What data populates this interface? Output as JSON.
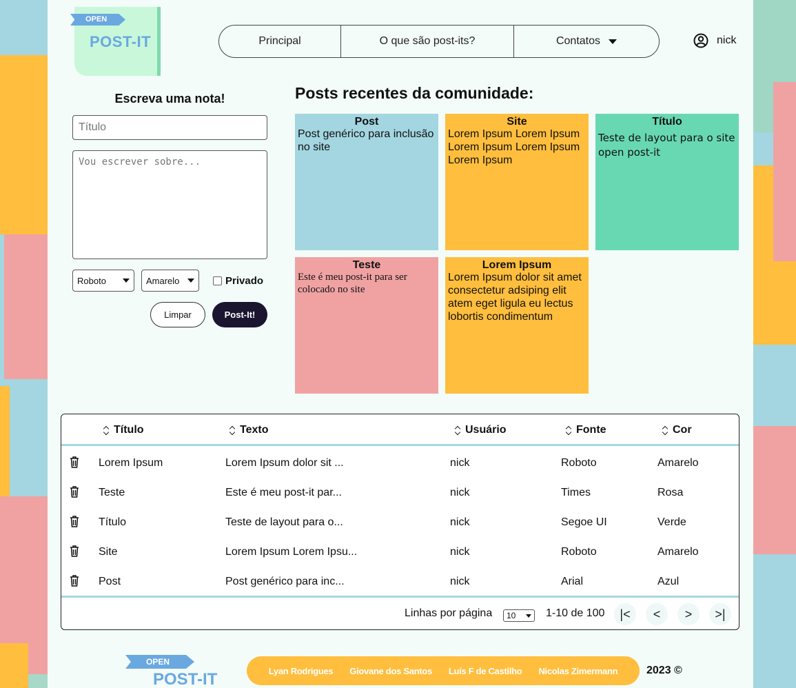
{
  "header": {
    "logo": {
      "ribbon": "OPEN",
      "word": "POST-IT"
    },
    "nav": {
      "principal": "Principal",
      "about": "O que são post-its?",
      "contacts": "Contatos"
    },
    "user": {
      "name": "nick"
    }
  },
  "form": {
    "title": "Escreva uma nota!",
    "title_placeholder": "Título",
    "body_placeholder": "Vou escrever sobre...",
    "font_select": "Roboto",
    "color_select": "Amarelo",
    "private_label": "Privado",
    "clear_label": "Limpar",
    "post_label": "Post-It!"
  },
  "posts": {
    "heading": "Posts recentes da comunidade:",
    "items": [
      {
        "title": "Post",
        "body": "Post genérico para inclusão no site",
        "color": "#a3d6e0"
      },
      {
        "title": "Site",
        "body": "Lorem Ipsum Lorem Ipsum Lorem Ipsum Lorem Ipsum Lorem Ipsum",
        "color": "#ffbe3d"
      },
      {
        "title": "Título",
        "body": "Teste de layout para o site open post-it",
        "color": "#68d8b3"
      },
      {
        "title": "Teste",
        "body": "Este é meu post-it para ser colocado no site",
        "color": "#f0a2a2"
      },
      {
        "title": "Lorem Ipsum",
        "body": "Lorem Ipsum dolor sit amet consectetur adsiping elit atem eget ligula eu lectus lobortis condimentum",
        "color": "#ffbe3d"
      }
    ]
  },
  "table": {
    "headers": [
      "Título",
      "Texto",
      "Usuário",
      "Fonte",
      "Cor"
    ],
    "rows": [
      [
        "Lorem Ipsum",
        "Lorem Ipsum dolor sit ...",
        "nick",
        "Roboto",
        "Amarelo"
      ],
      [
        "Teste",
        "Este é meu post-it par...",
        "nick",
        "Times",
        "Rosa"
      ],
      [
        "Título",
        "Teste de layout para o...",
        "nick",
        "Segoe UI",
        "Verde"
      ],
      [
        "Site",
        "Lorem Ipsum Lorem Ipsu...",
        "nick",
        "Roboto",
        "Amarelo"
      ],
      [
        "Post",
        "Post genérico para inc...",
        "nick",
        "Arial",
        "Azul"
      ]
    ],
    "footer": {
      "rows_per_page_label": "Linhas por página",
      "rows_per_page": "10",
      "range": "1-10 de 100",
      "first": "|<",
      "prev": "<",
      "next": ">",
      "last": ">|"
    }
  },
  "footer": {
    "logo": {
      "ribbon": "OPEN",
      "word": "POST-IT"
    },
    "authors": [
      "Lyan Rodrigues",
      "Giovane dos Santos",
      "Luís F de Castilho",
      "Nicolas Zimermann"
    ],
    "year": "2023 ©"
  }
}
